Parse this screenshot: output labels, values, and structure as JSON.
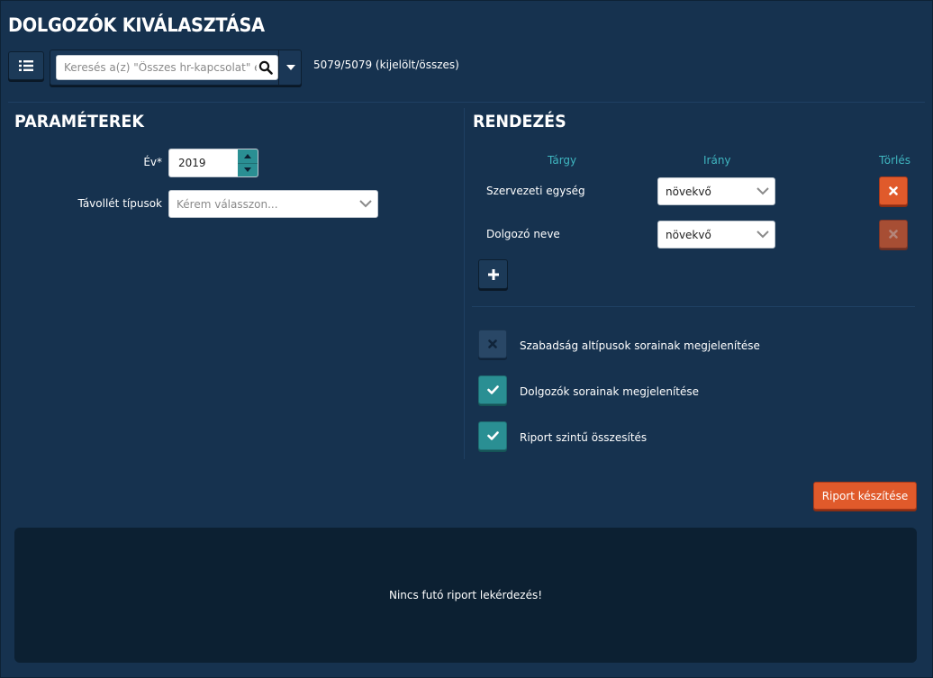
{
  "header": {
    "title": "DOLGOZÓK KIVÁLASZTÁSA",
    "search_placeholder": "Keresés a(z) \"Összes hr-kapcsolat\" ele",
    "count_text": "5079/5079 (kijelölt/összes)"
  },
  "parameters": {
    "title": "PARAMÉTEREK",
    "year_label": "Év*",
    "year_value": "2019",
    "absence_label": "Távollét típusok",
    "absence_placeholder": "Kérem válasszon..."
  },
  "sorting": {
    "title": "RENDEZÉS",
    "col_subject": "Tárgy",
    "col_direction": "Irány",
    "col_delete": "Törlés",
    "rows": [
      {
        "label": "Szervezeti egység",
        "direction": "növekvő",
        "delete_enabled": true
      },
      {
        "label": "Dolgozó neve",
        "direction": "növekvő",
        "delete_enabled": false
      }
    ]
  },
  "options": [
    {
      "label": "Szabadság altípusok sorainak megjelenítése",
      "checked": false
    },
    {
      "label": "Dolgozók sorainak megjelenítése",
      "checked": true
    },
    {
      "label": "Riport szintű összesítés",
      "checked": true
    }
  ],
  "actions": {
    "report_button": "Riport készítése"
  },
  "result": {
    "message": "Nincs futó riport lekérdezés!"
  },
  "colors": {
    "background": "#16324f",
    "accent_teal": "#2a8f93",
    "accent_orange": "#e05a2b",
    "header_text_teal": "#3fb6c0"
  }
}
